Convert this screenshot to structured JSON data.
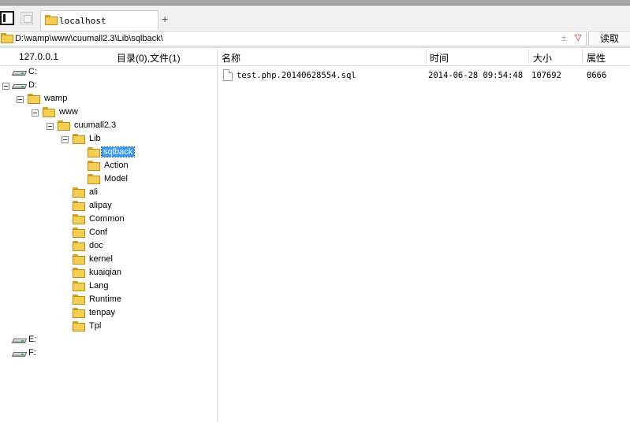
{
  "tab": {
    "label": "localhost"
  },
  "address": {
    "path": "D:\\wamp\\www\\cuumall2.3\\Lib\\sqlback\\",
    "plusminus": "±",
    "chevron": "▽"
  },
  "read_button": "读取",
  "header": {
    "host": "127.0.0.1",
    "summary": "目录(0),文件(1)",
    "col_name": "名称",
    "col_time": "时间",
    "col_size": "大小",
    "col_attr": "属性"
  },
  "tree": {
    "drive_c": "C:",
    "drive_d": "D:",
    "wamp": "wamp",
    "www": "www",
    "cuumall": "cuumall2.3",
    "lib": "Lib",
    "sqlback": "sqlback",
    "action": "Action",
    "model": "Model",
    "ali": "ali",
    "alipay": "alipay",
    "common": "Common",
    "conf": "Conf",
    "doc": "doc",
    "kernel": "kernel",
    "kuaiqian": "kuaiqian",
    "lang": "Lang",
    "runtime": "Runtime",
    "tenpay": "tenpay",
    "tpl": "Tpl",
    "drive_e": "E:",
    "drive_f": "F:"
  },
  "files": [
    {
      "name": "test.php.20140628554.sql",
      "time": "2014-06-28 09:54:48",
      "size": "107692",
      "attr": "0666"
    }
  ],
  "colors": {
    "selection": "#3399ff",
    "folder": "#f3cf58",
    "chevron": "#d00000"
  }
}
